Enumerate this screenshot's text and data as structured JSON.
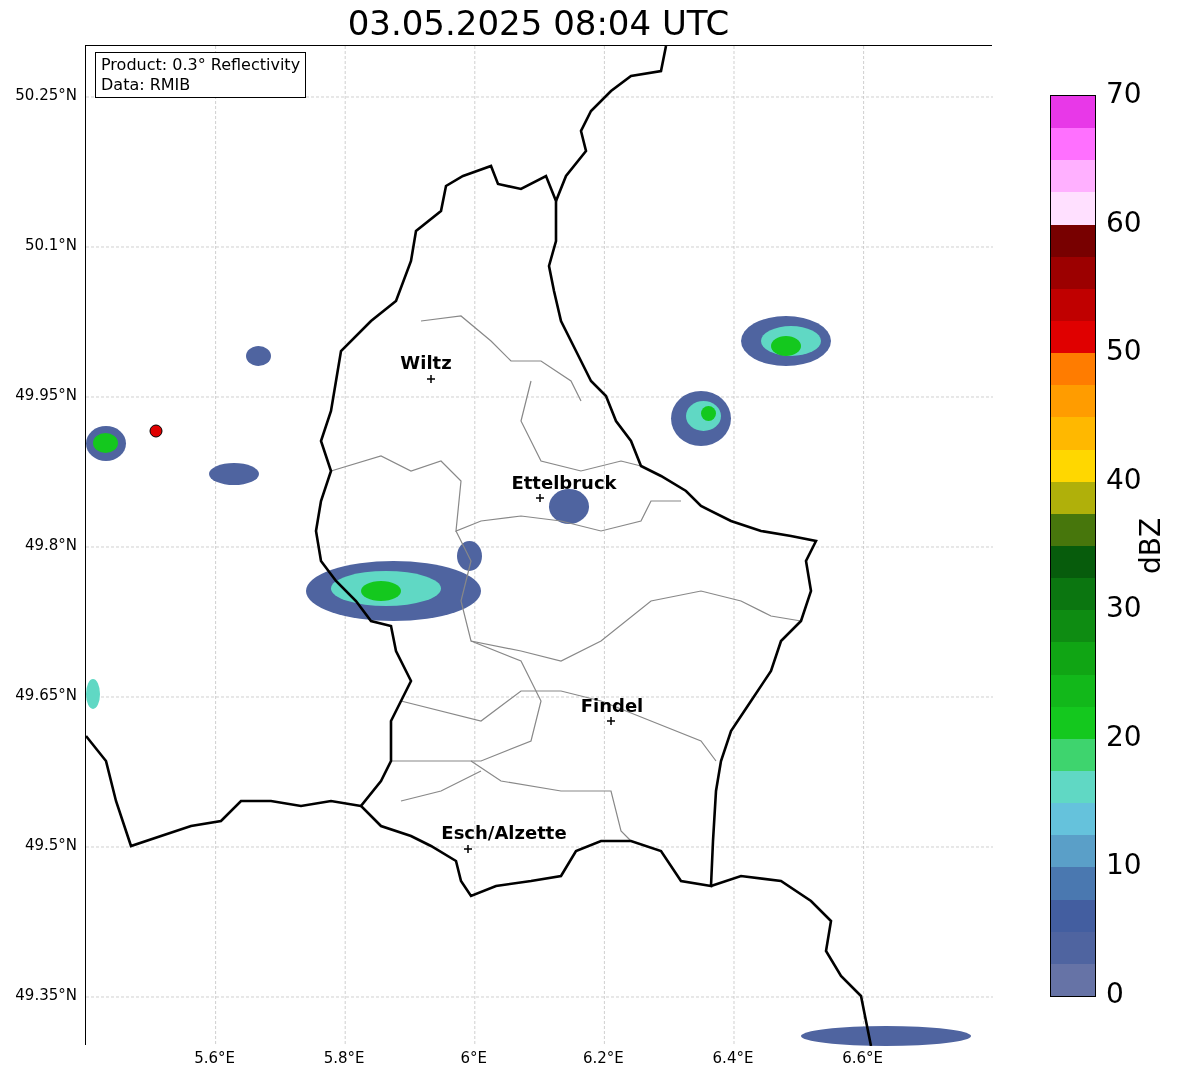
{
  "title": "03.05.2025 08:04 UTC",
  "info_box": [
    "Product: 0.3° Reflectivity",
    "Data: RMIB"
  ],
  "map": {
    "y_ticks": [
      "50.25°N",
      "50.1°N",
      "49.95°N",
      "49.8°N",
      "49.65°N",
      "49.5°N",
      "49.35°N"
    ],
    "x_ticks": [
      "5.6°E",
      "5.8°E",
      "6°E",
      "6.2°E",
      "6.4°E",
      "6.6°E"
    ],
    "cities": [
      {
        "name": "Wiltz"
      },
      {
        "name": "Ettelbruck"
      },
      {
        "name": "Findel"
      },
      {
        "name": "Esch/Alzette"
      }
    ]
  },
  "colorbar": {
    "label": "dBZ",
    "ticks": [
      "70",
      "60",
      "50",
      "40",
      "30",
      "20",
      "10",
      "0"
    ],
    "bands": [
      {
        "color": "#6673a6"
      },
      {
        "color": "#4f64a0"
      },
      {
        "color": "#435ea0"
      },
      {
        "color": "#4a78b0"
      },
      {
        "color": "#5a9fc8"
      },
      {
        "color": "#65c2dc"
      },
      {
        "color": "#60d8c4"
      },
      {
        "color": "#3ed46e"
      },
      {
        "color": "#14c81e"
      },
      {
        "color": "#12b81a"
      },
      {
        "color": "#10a514"
      },
      {
        "color": "#0e8c12"
      },
      {
        "color": "#0b7610"
      },
      {
        "color": "#075c0c"
      },
      {
        "color": "#47760c"
      },
      {
        "color": "#b0b00a"
      },
      {
        "color": "#ffd700"
      },
      {
        "color": "#ffb800"
      },
      {
        "color": "#ff9c00"
      },
      {
        "color": "#ff7c00"
      },
      {
        "color": "#e00000"
      },
      {
        "color": "#c00000"
      },
      {
        "color": "#9c0000"
      },
      {
        "color": "#780000"
      },
      {
        "color": "#ffe0ff"
      },
      {
        "color": "#ffb0ff"
      },
      {
        "color": "#ff70ff"
      },
      {
        "color": "#e838e8"
      }
    ]
  }
}
